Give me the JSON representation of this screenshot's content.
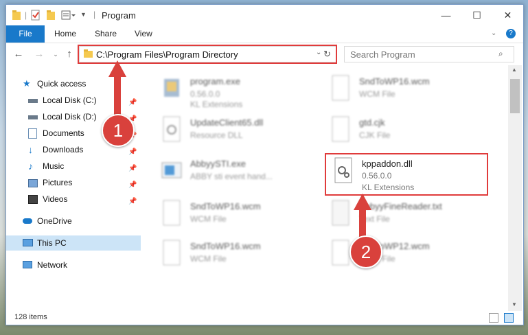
{
  "window": {
    "title": "Program"
  },
  "ribbon": {
    "file": "File",
    "home": "Home",
    "share": "Share",
    "view": "View"
  },
  "address": {
    "path": "C:\\Program Files\\Program Directory",
    "search_placeholder": "Search Program"
  },
  "nav": {
    "items": [
      {
        "label": "Quick access",
        "icon": "star-icon"
      },
      {
        "label": "Local Disk (C:)",
        "icon": "drive-icon"
      },
      {
        "label": "Local Disk (D:)",
        "icon": "drive-icon"
      },
      {
        "label": "Documents",
        "icon": "documents-icon"
      },
      {
        "label": "Downloads",
        "icon": "download-icon"
      },
      {
        "label": "Music",
        "icon": "music-icon"
      },
      {
        "label": "Pictures",
        "icon": "pictures-icon"
      },
      {
        "label": "Videos",
        "icon": "videos-icon"
      },
      {
        "label": "OneDrive",
        "icon": "cloud-icon"
      },
      {
        "label": "This PC",
        "icon": "computer-icon"
      },
      {
        "label": "Network",
        "icon": "network-icon"
      }
    ]
  },
  "files": [
    {
      "name": "program.exe",
      "sub": "0.56.0.0",
      "sub2": "KL Extensions"
    },
    {
      "name": "SndToWP16.wcm",
      "sub": "WCM File"
    },
    {
      "name": "UpdateClient65.dll",
      "sub": "Resource DLL"
    },
    {
      "name": "gtd.cjk",
      "sub": "CJK File"
    },
    {
      "name": "AbbyySTI.exe",
      "sub": "ABBY sti event hand..."
    },
    {
      "name": "kppaddon.dll",
      "sub": "0.56.0.0",
      "sub2": "KL Extensions"
    },
    {
      "name": "SndToWP16.wcm",
      "sub": "WCM File"
    },
    {
      "name": "AbbyyFineReader.txt",
      "sub": "Text File"
    },
    {
      "name": "SndToWP16.wcm",
      "sub": "WCM File"
    },
    {
      "name": "SndToWP12.wcm",
      "sub": "WCM File"
    }
  ],
  "status": {
    "count": "128 items"
  },
  "badges": {
    "one": "1",
    "two": "2"
  },
  "colors": {
    "accent": "#1979ca",
    "highlight": "#e03b3b"
  }
}
